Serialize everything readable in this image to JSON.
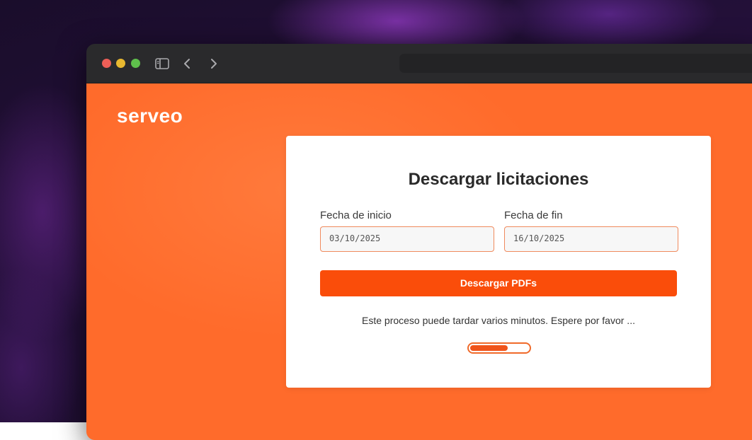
{
  "brand": {
    "name": "serveo"
  },
  "form": {
    "title": "Descargar licitaciones",
    "start_label": "Fecha de inicio",
    "start_value": "03/10/2025",
    "end_label": "Fecha de fin",
    "end_value": "16/10/2025",
    "button_label": "Descargar PDFs",
    "status_message": "Este proceso puede tardar varios minutos. Espere por favor ...",
    "progress_fraction": 0.65
  },
  "colors": {
    "page_background": "#ff6c2c",
    "accent": "#fa4d0a",
    "card_background": "#ffffff"
  },
  "icons": {
    "sidebar_toggle": "sidebar-toggle-icon",
    "back": "chevron-left-icon",
    "forward": "chevron-right-icon"
  }
}
